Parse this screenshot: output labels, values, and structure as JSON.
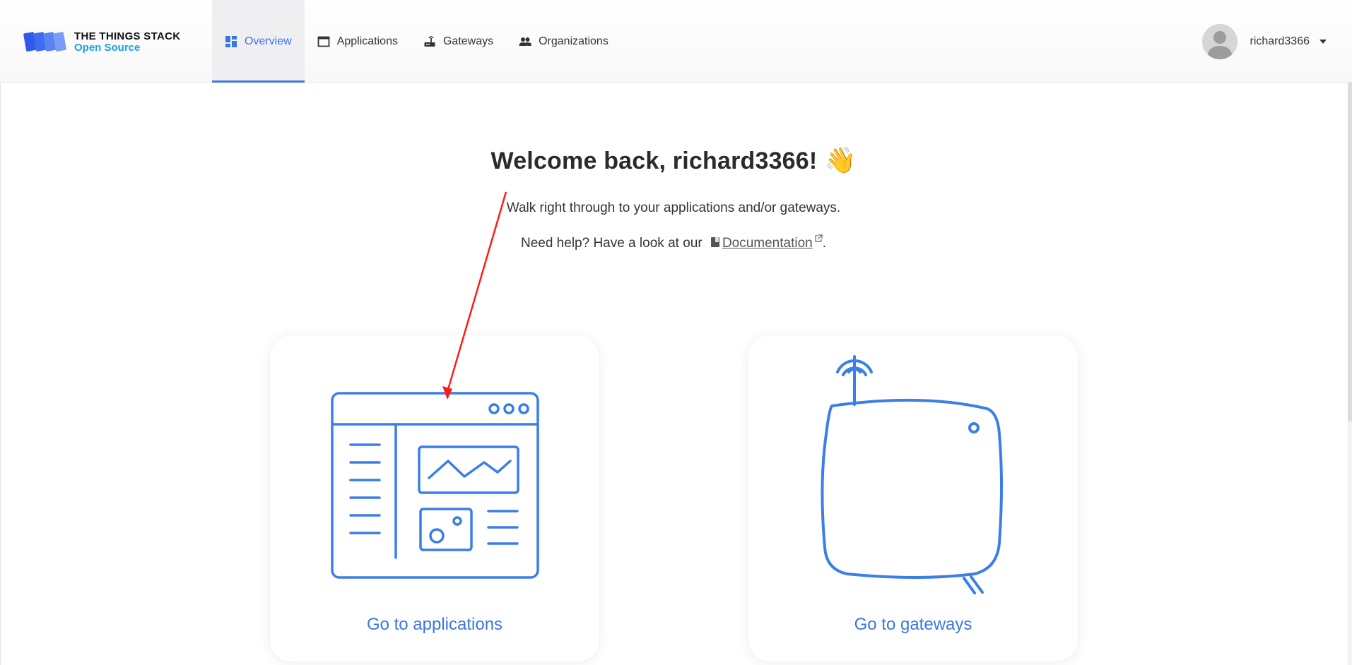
{
  "brand": {
    "title": "THE THINGS STACK",
    "subtitle": "Open Source",
    "colors": {
      "accent": "#3a75e6",
      "brand_sub": "#1aa0e6",
      "logo": "#2f5be8"
    }
  },
  "nav": {
    "items": [
      {
        "label": "Overview",
        "icon": "dashboard-icon",
        "active": true
      },
      {
        "label": "Applications",
        "icon": "window-icon",
        "active": false
      },
      {
        "label": "Gateways",
        "icon": "router-icon",
        "active": false
      },
      {
        "label": "Organizations",
        "icon": "people-icon",
        "active": false
      }
    ]
  },
  "user": {
    "name": "richard3366",
    "avatar": "person-avatar-icon"
  },
  "welcome": {
    "title": "Welcome back, richard3366!",
    "emoji": "👋",
    "subtitle": "Walk right through to your applications and/or gateways.",
    "help_prefix": "Need help? Have a look at our",
    "doc_link": "Documentation",
    "help_suffix": "."
  },
  "cards": {
    "applications": {
      "label": "Go to applications",
      "illustration": "application-window-icon"
    },
    "gateways": {
      "label": "Go to gateways",
      "illustration": "gateway-device-icon"
    }
  },
  "annotation": {
    "type": "red-arrow",
    "color": "#ff1a1a"
  }
}
